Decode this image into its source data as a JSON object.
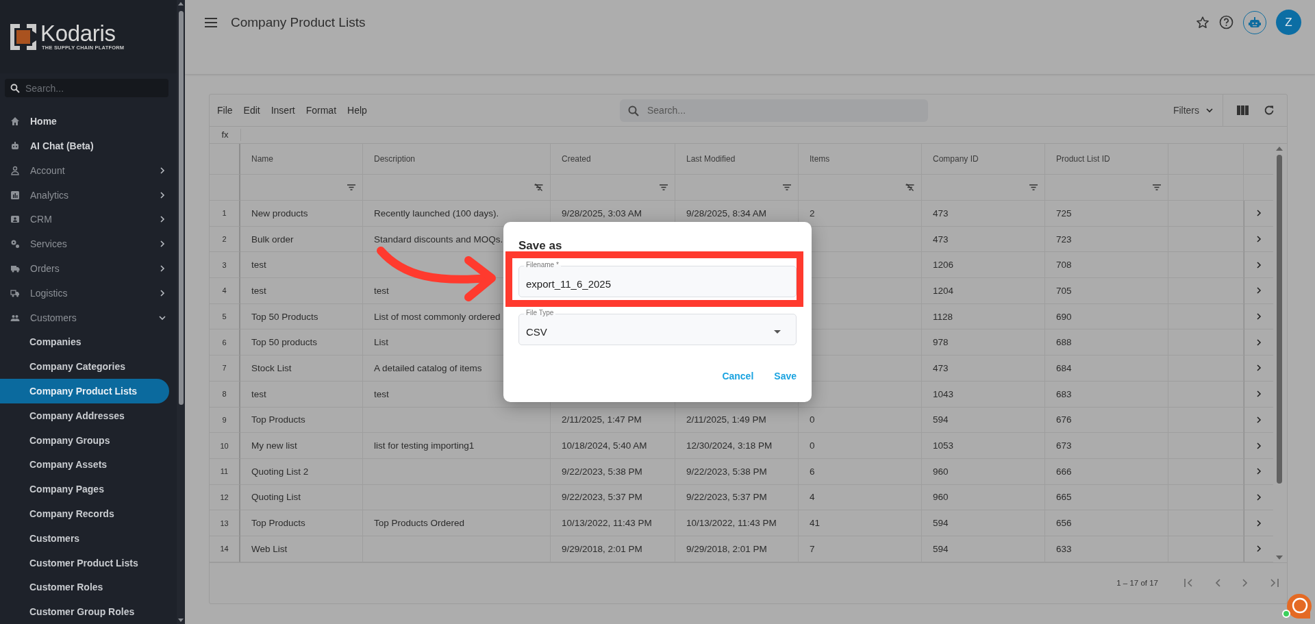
{
  "sidebar": {
    "logo": {
      "name": "Kodaris",
      "tagline": "THE SUPPLY CHAIN PLATFORM"
    },
    "search": {
      "placeholder": "Search..."
    },
    "items": [
      {
        "label": "Home",
        "kind": "link",
        "selected": false
      },
      {
        "label": "AI Chat (Beta)",
        "kind": "link",
        "selected": false
      },
      {
        "label": "Account",
        "kind": "group",
        "expanded": false,
        "selected": false
      },
      {
        "label": "Analytics",
        "kind": "group",
        "expanded": false,
        "selected": false
      },
      {
        "label": "CRM",
        "kind": "group",
        "expanded": false,
        "selected": false
      },
      {
        "label": "Services",
        "kind": "group",
        "expanded": false,
        "selected": false
      },
      {
        "label": "Orders",
        "kind": "group",
        "expanded": false,
        "selected": false
      },
      {
        "label": "Logistics",
        "kind": "group",
        "expanded": false,
        "selected": false
      },
      {
        "label": "Customers",
        "kind": "group",
        "expanded": true,
        "selected": false,
        "children": [
          {
            "label": "Companies",
            "selected": false
          },
          {
            "label": "Company Categories",
            "selected": false
          },
          {
            "label": "Company Product Lists",
            "selected": true
          },
          {
            "label": "Company Addresses",
            "selected": false
          },
          {
            "label": "Company Groups",
            "selected": false
          },
          {
            "label": "Company Assets",
            "selected": false
          },
          {
            "label": "Company Pages",
            "selected": false
          },
          {
            "label": "Company Records",
            "selected": false
          },
          {
            "label": "Customers",
            "selected": false
          },
          {
            "label": "Customer Product Lists",
            "selected": false
          },
          {
            "label": "Customer Roles",
            "selected": false
          },
          {
            "label": "Customer Group Roles",
            "selected": false
          }
        ]
      }
    ]
  },
  "header": {
    "title": "Company Product Lists",
    "avatar": "Z"
  },
  "toolbar": {
    "menu": [
      "File",
      "Edit",
      "Insert",
      "Format",
      "Help"
    ],
    "search": {
      "placeholder": "Search..."
    },
    "filters": "Filters"
  },
  "formula_bar": {
    "label": "fx"
  },
  "table": {
    "columns": [
      {
        "label": "Name",
        "filter_enabled": true
      },
      {
        "label": "Description",
        "filter_enabled": false
      },
      {
        "label": "Created",
        "filter_enabled": true
      },
      {
        "label": "Last Modified",
        "filter_enabled": true
      },
      {
        "label": "Items",
        "filter_enabled": false
      },
      {
        "label": "Company ID",
        "filter_enabled": true
      },
      {
        "label": "Product List ID",
        "filter_enabled": true
      }
    ],
    "rows": [
      {
        "number": "1",
        "cells": [
          "New products",
          "Recently launched (100 days).",
          "9/28/2025, 3:03 AM",
          "9/28/2025, 8:34 AM",
          "2",
          "473",
          "725"
        ]
      },
      {
        "number": "2",
        "cells": [
          "Bulk order",
          "Standard discounts and MOQs.",
          null,
          null,
          null,
          "473",
          "723"
        ]
      },
      {
        "number": "3",
        "cells": [
          "test",
          null,
          null,
          null,
          null,
          "1206",
          "708"
        ]
      },
      {
        "number": "4",
        "cells": [
          "test",
          "test",
          null,
          null,
          null,
          "1204",
          "705"
        ]
      },
      {
        "number": "5",
        "cells": [
          "Top 50 Products",
          "List of most commonly ordered",
          null,
          null,
          null,
          "1128",
          "690"
        ]
      },
      {
        "number": "6",
        "cells": [
          "Top 50 products",
          "List",
          null,
          null,
          null,
          "978",
          "688"
        ]
      },
      {
        "number": "7",
        "cells": [
          "Stock List",
          "A detailed catalog of items",
          null,
          null,
          null,
          "473",
          "684"
        ]
      },
      {
        "number": "8",
        "cells": [
          "test",
          "test",
          null,
          null,
          null,
          "1043",
          "683"
        ]
      },
      {
        "number": "9",
        "cells": [
          "Top Products",
          null,
          "2/11/2025, 1:47 PM",
          "2/11/2025, 1:49 PM",
          "0",
          "594",
          "676"
        ]
      },
      {
        "number": "10",
        "cells": [
          "My new list",
          "list for testing importing1",
          "10/18/2024, 5:40 AM",
          "12/30/2024, 3:18 PM",
          "0",
          "1053",
          "673"
        ]
      },
      {
        "number": "11",
        "cells": [
          "Quoting List 2",
          null,
          "9/22/2023, 5:38 PM",
          "9/22/2023, 5:38 PM",
          "6",
          "960",
          "666"
        ]
      },
      {
        "number": "12",
        "cells": [
          "Quoting List",
          null,
          "9/22/2023, 5:37 PM",
          "9/22/2023, 5:37 PM",
          "4",
          "960",
          "665"
        ]
      },
      {
        "number": "13",
        "cells": [
          "Top Products",
          "Top Products Ordered",
          "10/13/2022, 11:43 PM",
          "10/13/2022, 11:43 PM",
          "41",
          "594",
          "656"
        ]
      },
      {
        "number": "14",
        "cells": [
          "Web List",
          null,
          "9/29/2018, 2:01 PM",
          "9/29/2018, 2:01 PM",
          "7",
          "594",
          "633"
        ]
      }
    ],
    "pagination": "1 – 17 of 17"
  },
  "dialog": {
    "title": "Save as",
    "fields": [
      {
        "kind": "text",
        "label": "Filename *",
        "value": "export_11_6_2025"
      },
      {
        "kind": "select",
        "label": "File Type",
        "value": "CSV"
      }
    ],
    "buttons": [
      "Cancel",
      "Save"
    ]
  }
}
